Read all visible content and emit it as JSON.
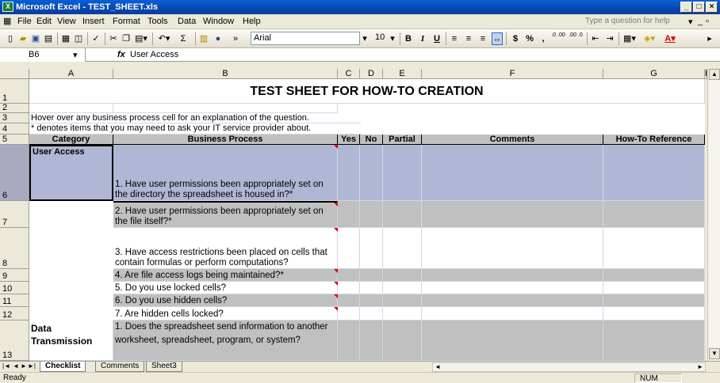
{
  "window": {
    "title": "Microsoft Excel - TEST_SHEET.xls"
  },
  "menu": [
    "File",
    "Edit",
    "View",
    "Insert",
    "Format",
    "Tools",
    "Data",
    "Window",
    "Help"
  ],
  "help_placeholder": "Type a question for help",
  "toolbar": {
    "font": "Arial",
    "size": "10",
    "bold": "B",
    "italic": "I",
    "underline": "U",
    "currency": "$",
    "percent": "%",
    "comma": ",",
    "inc_dec": ".0 .00",
    "dec_dec": ".00 .0",
    "sum": "Σ"
  },
  "formula": {
    "cell": "B6",
    "fx": "fx",
    "value": "User Access"
  },
  "columns": [
    "A",
    "B",
    "C",
    "D",
    "E",
    "F",
    "G",
    "H"
  ],
  "rows": [
    "1",
    "2",
    "3",
    "4",
    "5",
    "6",
    "7",
    "8",
    "9",
    "10",
    "11",
    "12",
    "13"
  ],
  "sheet": {
    "title": "TEST SHEET FOR HOW-TO CREATION",
    "note1": "Hover over any business process cell for an explanation of the question.",
    "note2": "* denotes items that you may need to ask your IT service provider about.",
    "headers": {
      "category": "Category",
      "process": "Business Process",
      "yes": "Yes",
      "no": "No",
      "partial": "Partial",
      "comments": "Comments",
      "howto": "How-To Reference"
    },
    "user_access": "User Access",
    "q1": "1. Have user permissions been appropriately set on the directory the spreadsheet is housed in?*",
    "q2": "2. Have user permissions been appropriately set on the file itself?*",
    "q3": "3. Have access restrictions been placed on cells that contain formulas or perform computations?",
    "q4": "4. Are file access logs being maintained?*",
    "q5": "5. Do you use locked cells?",
    "q6": "6. Do you use hidden cells?",
    "q7": "7. Are hidden cells locked?",
    "data_transmission": "Data Transmission",
    "dq1": "1. Does the spreadsheet send information to another worksheet, spreadsheet, program, or system?"
  },
  "tabs": [
    "Checklist",
    "Comments",
    "Sheet3"
  ],
  "status": {
    "left": "Ready",
    "right": "NUM"
  }
}
